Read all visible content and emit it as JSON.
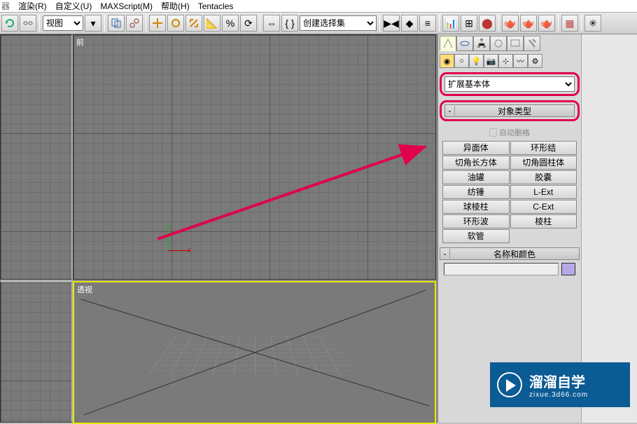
{
  "menu": {
    "m0": "器",
    "m1": "渲染(R)",
    "m2": "自定义(U)",
    "m3": "MAXScript(M)",
    "m4": "帮助(H)",
    "m5": "Tentacles"
  },
  "toolbar": {
    "view_label": "视图",
    "selection_set": "创建选择集"
  },
  "viewports": {
    "front": "前",
    "persp": "透视",
    "axis_z": "z",
    "axis_x": "x"
  },
  "panel": {
    "category": "扩展基本体",
    "rollout_objtype": "对象类型",
    "autogrid": "自动删格",
    "buttons": {
      "b0": "异面体",
      "b1": "环形结",
      "b2": "切角长方体",
      "b3": "切角圆柱体",
      "b4": "油罐",
      "b5": "胶囊",
      "b6": "纺锤",
      "b7": "L-Ext",
      "b8": "球棱柱",
      "b9": "C-Ext",
      "b10": "环形波",
      "b11": "棱柱",
      "b12": "软管"
    },
    "rollout_namecolor": "名称和颜色"
  },
  "watermark": {
    "title": "溜溜自学",
    "url": "zixue.3d66.com"
  }
}
